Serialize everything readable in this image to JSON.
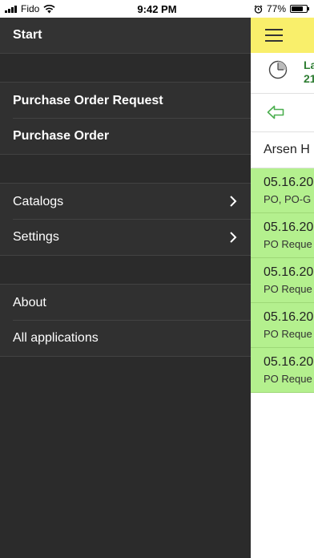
{
  "status_bar": {
    "carrier": "Fido",
    "time": "9:42 PM",
    "battery": "77%",
    "battery_level": 0.77
  },
  "menu": {
    "start": "Start",
    "purchase_order_request": "Purchase Order Request",
    "purchase_order": "Purchase Order",
    "catalogs": "Catalogs",
    "settings": "Settings",
    "about": "About",
    "all_applications": "All applications"
  },
  "main": {
    "info_line1": "La",
    "info_line2": "21",
    "user": "Arsen H",
    "entries": [
      {
        "date": "05.16.20",
        "desc": "PO, PO-G"
      },
      {
        "date": "05.16.20",
        "desc": "PO Reque"
      },
      {
        "date": "05.16.20",
        "desc": "PO Reque"
      },
      {
        "date": "05.16.20",
        "desc": "PO Reque"
      },
      {
        "date": "05.16.20",
        "desc": "PO Reque"
      }
    ]
  },
  "colors": {
    "menu_bg": "#2b2b2b",
    "appbar": "#f9ef6b",
    "entry_bg": "#b4f08e",
    "accent_green": "#2e7d32"
  },
  "icons": {
    "status_left": [
      "signal-icon",
      "wifi-icon"
    ],
    "status_right": [
      "alarm-icon",
      "battery-icon"
    ],
    "menu": [
      "chevron-right-icon"
    ],
    "main": [
      "hamburger-icon",
      "clock-icon",
      "back-arrow-icon"
    ]
  }
}
